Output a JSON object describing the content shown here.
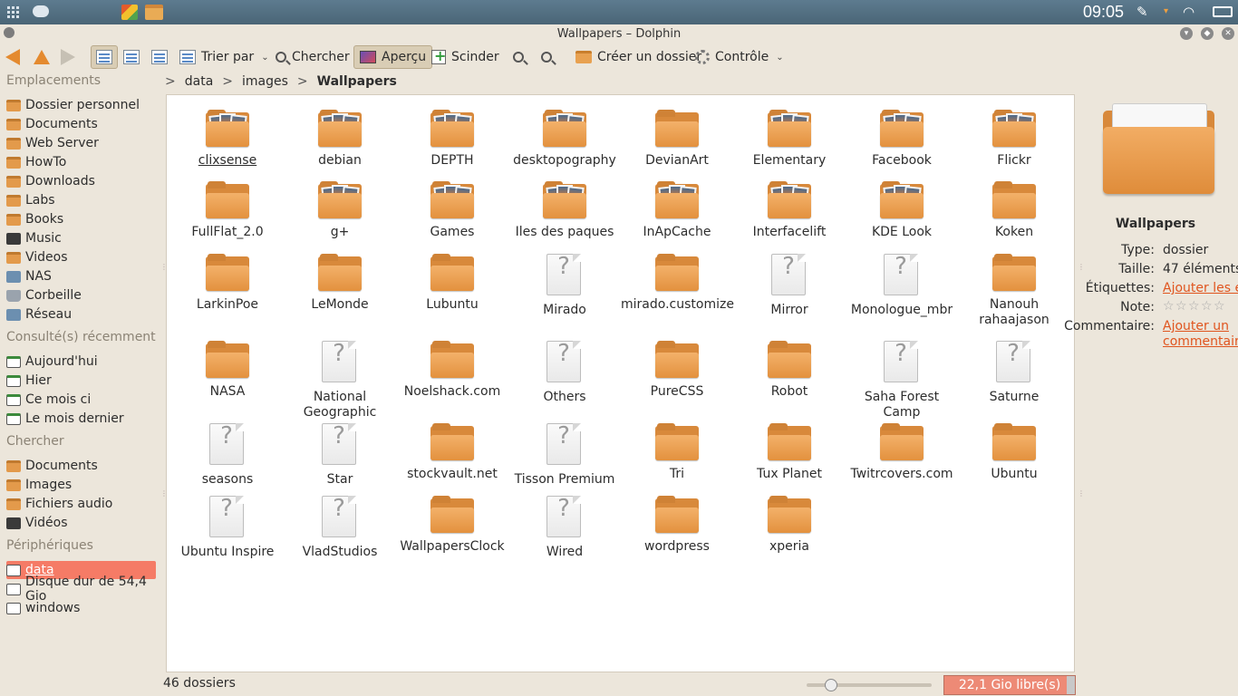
{
  "panel": {
    "clock": "09:05"
  },
  "window": {
    "title": "Wallpapers – Dolphin"
  },
  "toolbar": {
    "sort_label": "Trier par",
    "search_label": "Chercher",
    "preview_label": "Aperçu",
    "split_label": "Scinder",
    "new_folder_label": "Créer un dossier",
    "control_label": "Contrôle"
  },
  "sidebar": {
    "places_title": "Emplacements",
    "places": [
      {
        "label": "Dossier personnel",
        "icon": "home-folder-icon"
      },
      {
        "label": "Documents",
        "icon": "folder-icon"
      },
      {
        "label": "Web Server",
        "icon": "folder-icon"
      },
      {
        "label": "HowTo",
        "icon": "folder-icon"
      },
      {
        "label": "Downloads",
        "icon": "folder-icon"
      },
      {
        "label": "Labs",
        "icon": "folder-icon"
      },
      {
        "label": "Books",
        "icon": "folder-icon"
      },
      {
        "label": "Music",
        "icon": "music-folder-icon"
      },
      {
        "label": "Videos",
        "icon": "folder-icon"
      },
      {
        "label": "NAS",
        "icon": "network-folder-icon"
      },
      {
        "label": "Corbeille",
        "icon": "trash-icon"
      },
      {
        "label": "Réseau",
        "icon": "network-icon"
      }
    ],
    "recent_title": "Consulté(s) récemment",
    "recent": [
      {
        "label": "Aujourd'hui",
        "icon": "calendar-icon"
      },
      {
        "label": "Hier",
        "icon": "calendar-icon"
      },
      {
        "label": "Ce mois ci",
        "icon": "calendar-icon"
      },
      {
        "label": "Le mois dernier",
        "icon": "calendar-icon"
      }
    ],
    "search_title": "Chercher",
    "search": [
      {
        "label": "Documents",
        "icon": "folder-icon"
      },
      {
        "label": "Images",
        "icon": "folder-icon"
      },
      {
        "label": "Fichiers audio",
        "icon": "folder-icon"
      },
      {
        "label": "Vidéos",
        "icon": "video-icon"
      }
    ],
    "devices_title": "Périphériques",
    "devices": [
      {
        "label": "data",
        "icon": "drive-icon",
        "active": true
      },
      {
        "label": "Disque dur de 54,4 Gio",
        "icon": "drive-icon"
      },
      {
        "label": "windows",
        "icon": "drive-icon"
      }
    ]
  },
  "breadcrumb": [
    "data",
    "images",
    "Wallpapers"
  ],
  "files": [
    {
      "name": "clixsense",
      "type": "folder-photos"
    },
    {
      "name": "debian",
      "type": "folder-photos"
    },
    {
      "name": "DEPTH",
      "type": "folder-photos"
    },
    {
      "name": "desktopography",
      "type": "folder-photos"
    },
    {
      "name": "DevianArt",
      "type": "folder"
    },
    {
      "name": "Elementary",
      "type": "folder-photos"
    },
    {
      "name": "Facebook",
      "type": "folder-photos"
    },
    {
      "name": "Flickr",
      "type": "folder-photos"
    },
    {
      "name": "FullFlat_2.0",
      "type": "folder"
    },
    {
      "name": "g+",
      "type": "folder-photos"
    },
    {
      "name": "Games",
      "type": "folder-photos"
    },
    {
      "name": "Iles des paques",
      "type": "folder-photos"
    },
    {
      "name": "InApCache",
      "type": "folder-photos"
    },
    {
      "name": "Interfacelift",
      "type": "folder-photos"
    },
    {
      "name": "KDE Look",
      "type": "folder-photos"
    },
    {
      "name": "Koken",
      "type": "folder"
    },
    {
      "name": "LarkinPoe",
      "type": "folder"
    },
    {
      "name": "LeMonde",
      "type": "folder"
    },
    {
      "name": "Lubuntu",
      "type": "folder"
    },
    {
      "name": "Mirado",
      "type": "unknown"
    },
    {
      "name": "mirado.customize",
      "type": "folder"
    },
    {
      "name": "Mirror",
      "type": "unknown"
    },
    {
      "name": "Monologue_mbr",
      "type": "unknown"
    },
    {
      "name": "Nanouh rahaajason",
      "type": "folder"
    },
    {
      "name": "NASA",
      "type": "folder"
    },
    {
      "name": "National Geographic",
      "type": "unknown"
    },
    {
      "name": "Noelshack.com",
      "type": "folder"
    },
    {
      "name": "Others",
      "type": "unknown"
    },
    {
      "name": "PureCSS",
      "type": "folder"
    },
    {
      "name": "Robot",
      "type": "folder"
    },
    {
      "name": "Saha Forest Camp",
      "type": "unknown"
    },
    {
      "name": "Saturne",
      "type": "unknown"
    },
    {
      "name": "seasons",
      "type": "unknown"
    },
    {
      "name": "Star",
      "type": "unknown"
    },
    {
      "name": "stockvault.net",
      "type": "folder"
    },
    {
      "name": "Tisson Premium",
      "type": "unknown"
    },
    {
      "name": "Tri",
      "type": "folder"
    },
    {
      "name": "Tux Planet",
      "type": "folder"
    },
    {
      "name": "Twitrcovers.com",
      "type": "folder"
    },
    {
      "name": "Ubuntu",
      "type": "folder"
    },
    {
      "name": "Ubuntu Inspire",
      "type": "unknown"
    },
    {
      "name": "VladStudios",
      "type": "unknown"
    },
    {
      "name": "WallpapersClock",
      "type": "folder"
    },
    {
      "name": "Wired",
      "type": "unknown"
    },
    {
      "name": "wordpress",
      "type": "folder"
    },
    {
      "name": "xperia",
      "type": "folder"
    }
  ],
  "info": {
    "name": "Wallpapers",
    "type_key": "Type:",
    "type_val": "dossier",
    "size_key": "Taille:",
    "size_val": "47 éléments",
    "tags_key": "Étiquettes:",
    "tags_val": "Ajouter les éti",
    "rating_key": "Note:",
    "comment_key": "Commentaire:",
    "comment_val1": "Ajouter un",
    "comment_val2": "commentaire."
  },
  "status": {
    "count": "46 dossiers",
    "free_space": "22,1 Gio libre(s)",
    "zoom_level": 0.16
  },
  "colors": {
    "accent": "#e48a2f",
    "folder": "#e3913e",
    "selection": "#f57b66",
    "link": "#e0551f"
  }
}
